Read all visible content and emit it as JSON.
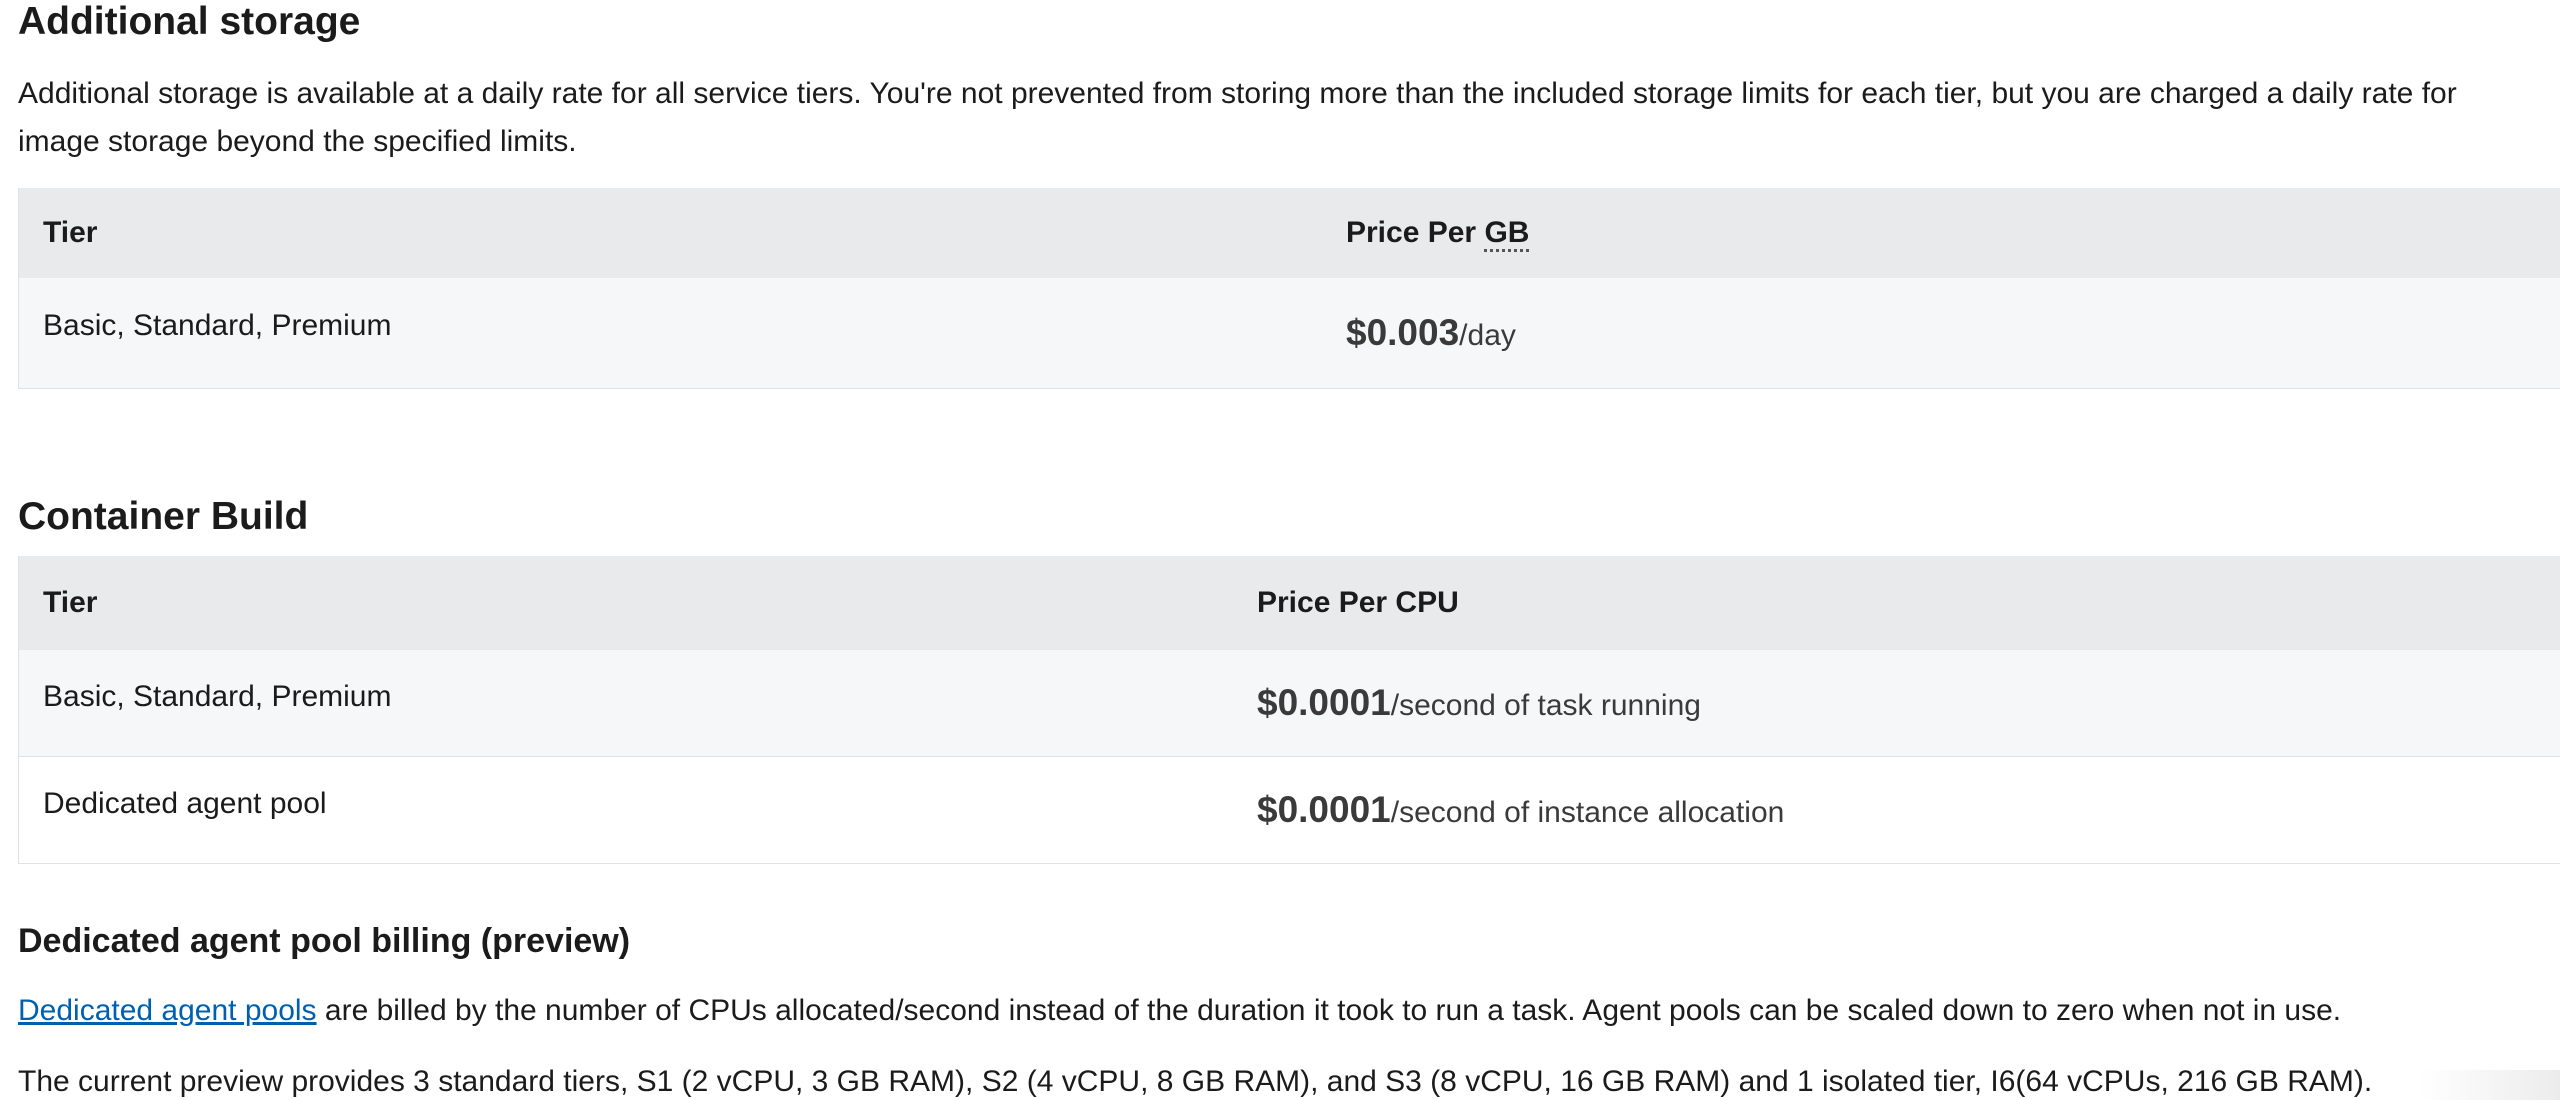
{
  "additional_storage": {
    "title": "Additional storage",
    "description": "Additional storage is available at a daily rate for all service tiers. You're not prevented from storing more than the included storage limits for each tier, but you are charged a daily rate for image storage beyond the specified limits.",
    "table": {
      "col_tier": "Tier",
      "col_price_prefix": "Price Per ",
      "col_price_abbr": "GB",
      "rows": [
        {
          "tier": "Basic, Standard, Premium",
          "amount": "$0.003",
          "unit": "/day"
        }
      ]
    }
  },
  "container_build": {
    "title": "Container Build",
    "table": {
      "col_tier": "Tier",
      "col_price": "Price Per CPU",
      "rows": [
        {
          "tier": "Basic, Standard, Premium",
          "amount": "$0.0001",
          "unit": "/second of task running"
        },
        {
          "tier": "Dedicated agent pool",
          "amount": "$0.0001",
          "unit": "/second of instance allocation"
        }
      ]
    }
  },
  "dedicated_billing": {
    "title": "Dedicated agent pool billing (preview)",
    "link_text": "Dedicated agent pools",
    "paragraph1_rest": " are billed by the number of CPUs allocated/second instead of the duration it took to run a task. Agent pools can be scaled down to zero when not in use.",
    "paragraph2": "The current preview provides 3 standard tiers, S1 (2 vCPU, 3 GB RAM), S2 (4 vCPU, 8 GB RAM), and S3 (8 vCPU, 16 GB RAM) and 1 isolated tier, I6(64 vCPUs, 216 GB RAM)."
  }
}
